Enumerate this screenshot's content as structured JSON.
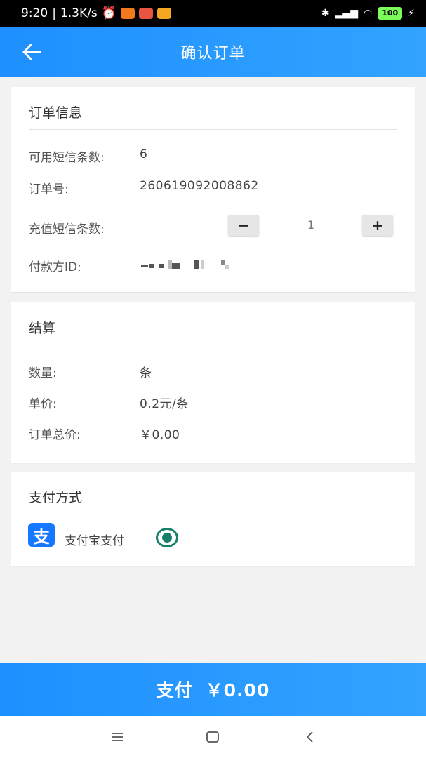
{
  "status_bar": {
    "time": "9:20",
    "speed": "1.3K/s",
    "battery": "100"
  },
  "app_bar": {
    "title": "确认订单"
  },
  "order_info": {
    "title": "订单信息",
    "available_sms_label": "可用短信条数:",
    "available_sms_value": "6",
    "order_no_label": "订单号:",
    "order_no_value": "260619092008862",
    "recharge_label": "充值短信条数:",
    "recharge_qty": "1",
    "minus_label": "−",
    "plus_label": "+",
    "payer_label": "付款方ID:"
  },
  "settlement": {
    "title": "结算",
    "quantity_label": "数量:",
    "quantity_value": "条",
    "unit_price_label": "单价:",
    "unit_price_value": "0.2元/条",
    "total_label": "订单总价:",
    "total_value": "￥0.00"
  },
  "payment_method": {
    "title": "支付方式",
    "alipay_icon_text": "支",
    "alipay_label": "支付宝支付",
    "selected": true,
    "accent_color": "#17806a"
  },
  "pay_button": {
    "label": "支付",
    "amount": "￥0.00"
  },
  "colors": {
    "primary": "#1e90ff",
    "alipay": "#1677ff"
  }
}
